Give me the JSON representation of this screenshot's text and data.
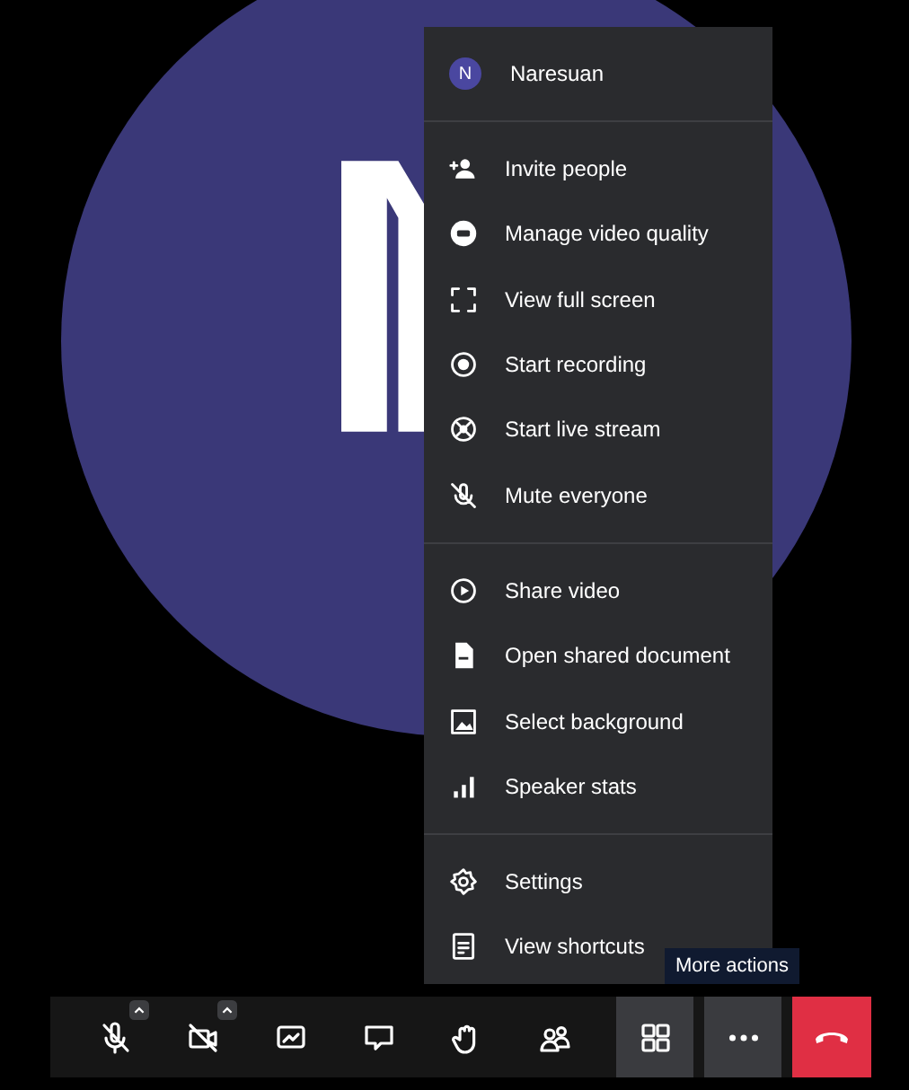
{
  "menu": {
    "user": {
      "initial": "N",
      "name": "Naresuan"
    },
    "sections": [
      [
        {
          "label": "Invite people"
        },
        {
          "label": "Manage video quality"
        },
        {
          "label": "View full screen"
        },
        {
          "label": "Start recording"
        },
        {
          "label": "Start live stream"
        },
        {
          "label": "Mute everyone"
        }
      ],
      [
        {
          "label": "Share video"
        },
        {
          "label": "Open shared document"
        },
        {
          "label": "Select background"
        },
        {
          "label": "Speaker stats"
        }
      ],
      [
        {
          "label": "Settings"
        },
        {
          "label": "View shortcuts"
        }
      ]
    ]
  },
  "tooltip": "More actions",
  "toolbar": [
    {
      "kind": "control",
      "caret": true,
      "selected": false
    },
    {
      "kind": "control",
      "caret": true,
      "selected": false
    },
    {
      "kind": "control",
      "caret": false,
      "selected": false
    },
    {
      "kind": "control",
      "caret": false,
      "selected": false
    },
    {
      "kind": "control",
      "caret": false,
      "selected": false
    },
    {
      "kind": "control",
      "caret": false,
      "selected": false
    },
    {
      "kind": "control",
      "caret": false,
      "selected": true
    },
    {
      "kind": "control",
      "caret": false,
      "selected": true
    },
    {
      "kind": "hangup",
      "caret": false,
      "selected": false
    }
  ]
}
